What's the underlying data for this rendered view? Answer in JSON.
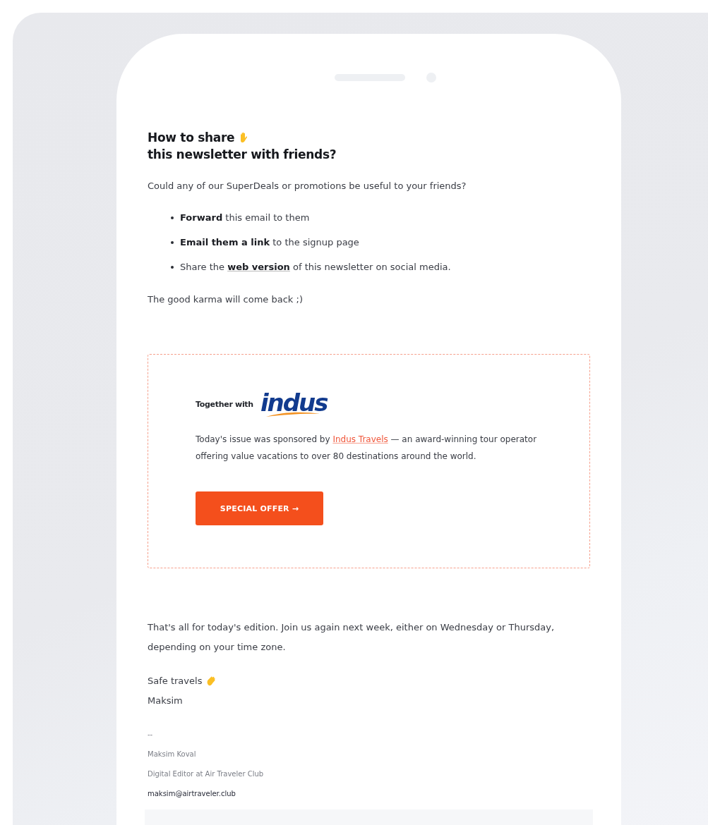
{
  "heading": {
    "line_1": "How to share",
    "line_2": "this newsletter with friends?"
  },
  "intro": "Could any of our SuperDeals or promotions be useful to your friends?",
  "share_options": [
    {
      "parts": [
        {
          "kind": "bold",
          "text": "Forward"
        },
        {
          "kind": "plain",
          "text": " this email to them"
        }
      ]
    },
    {
      "parts": [
        {
          "kind": "bold",
          "text": "Email them a link"
        },
        {
          "kind": "plain",
          "text": " to the signup page"
        }
      ]
    },
    {
      "parts": [
        {
          "kind": "plain",
          "text": "Share the "
        },
        {
          "kind": "link",
          "text": "web version"
        },
        {
          "kind": "plain",
          "text": " of this newsletter on social media."
        }
      ]
    }
  ],
  "karma": "The good karma will come back ;)",
  "sponsor": {
    "together_with": "Together with",
    "logo_text": "indus",
    "parts": [
      {
        "kind": "plain",
        "text": "Today's issue was sponsored by "
      },
      {
        "kind": "link",
        "text": "Indus Travels"
      },
      {
        "kind": "plain",
        "text": " — an award-winning tour operator offering value vacations to over 80 destinations around the world."
      }
    ],
    "button": "SPECIAL OFFER →"
  },
  "closing": "That's all for today's edition. Join us again next week, either on Wednesday or Thursday, depending on your time zone.",
  "sign_off": "Safe travels",
  "signer": "Maksim",
  "signature": {
    "separator": "--",
    "name": "Maksim Koval",
    "role": "Digital Editor at Air Traveler Club",
    "email": "maksim@airtraveler.club"
  }
}
